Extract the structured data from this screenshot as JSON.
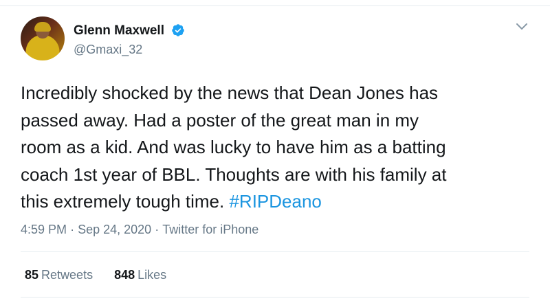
{
  "tweet": {
    "author_name": "Glenn Maxwell",
    "author_handle": "@Gmaxi_32",
    "verified_icon": "verified-badge-icon",
    "menu_icon": "chevron-down-icon",
    "text_lines": [
      "Incredibly shocked by the news that Dean Jones has",
      "passed away. Had a poster of the great man in my",
      "room as a kid. And was lucky to have him as a batting",
      "coach 1st year of BBL. Thoughts are with his family at",
      "this extremely tough time."
    ],
    "hashtag": "#RIPDeano",
    "time": "4:59 PM",
    "date": "Sep 24, 2020",
    "source": "Twitter for iPhone",
    "separator": "·",
    "retweets_count": "85",
    "retweets_label": "Retweets",
    "likes_count": "848",
    "likes_label": "Likes"
  },
  "colors": {
    "link": "#1b95e0",
    "secondary_text": "#657786",
    "primary_text": "#14171a",
    "divider": "#e6ecf0"
  }
}
